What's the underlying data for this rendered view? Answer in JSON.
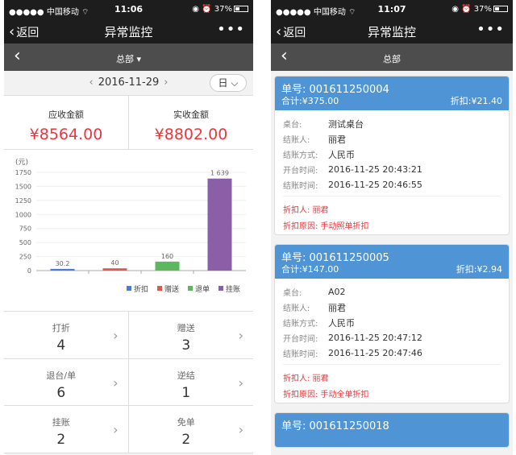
{
  "status_bar": {
    "left": [
      {
        "signal": "●●●●●",
        "carrier": "中国移动",
        "wifi": "⌔",
        "time": "11:06",
        "alarm": "◉ ⏰",
        "battery": "37%",
        "battery_level": 0.37
      },
      {
        "signal": "●●●●●",
        "carrier": "中国移动",
        "wifi": "⌔",
        "time": "11:07",
        "alarm": "◉ ⏰",
        "battery": "37%",
        "battery_level": 0.37
      }
    ]
  },
  "nav": {
    "back": "返回",
    "title": "异常监控",
    "more": "•••"
  },
  "left": {
    "sub_title": "总部 ▾",
    "date": "2016-11-29",
    "period": "日 ⌵",
    "receivable_label": "应收金额",
    "receivable_value": "¥8564.00",
    "received_label": "实收金额",
    "received_value": "¥8802.00",
    "grid": [
      {
        "label": "打折",
        "count": "4"
      },
      {
        "label": "赠送",
        "count": "3"
      },
      {
        "label": "退台/单",
        "count": "6"
      },
      {
        "label": "逆结",
        "count": "1"
      },
      {
        "label": "挂账",
        "count": "2"
      },
      {
        "label": "免单",
        "count": "2"
      }
    ]
  },
  "right": {
    "sub_title": "总部",
    "cards": [
      {
        "no_label": "单号:",
        "no": "001611250004",
        "sum_label": "合计:",
        "sum": "¥375.00",
        "disc_label": "折扣:",
        "disc": "¥21.40",
        "rows": [
          {
            "k": "桌台:",
            "v": "测试桌台"
          },
          {
            "k": "结账人:",
            "v": "丽君"
          },
          {
            "k": "结账方式:",
            "v": "人民币"
          },
          {
            "k": "开台时间:",
            "v": "2016-11-25 20:43:21"
          },
          {
            "k": "结账时间:",
            "v": "2016-11-25 20:46:55"
          }
        ],
        "discounter": "折扣人: 丽君",
        "reason": "折扣原因: 手动照单折扣"
      },
      {
        "no_label": "单号:",
        "no": "001611250005",
        "sum_label": "合计:",
        "sum": "¥147.00",
        "disc_label": "折扣:",
        "disc": "¥2.94",
        "rows": [
          {
            "k": "桌台:",
            "v": "A02"
          },
          {
            "k": "结账人:",
            "v": "丽君"
          },
          {
            "k": "结账方式:",
            "v": "人民币"
          },
          {
            "k": "开台时间:",
            "v": "2016-11-25 20:47:12"
          },
          {
            "k": "结账时间:",
            "v": "2016-11-25 20:47:46"
          }
        ],
        "discounter": "折扣人: 丽君",
        "reason": "折扣原因: 手动全单折扣"
      },
      {
        "no_label": "单号:",
        "no": "001611250018"
      }
    ]
  },
  "colors": {
    "accent_blue": "#4f94d4",
    "money_red": "#e8383d",
    "dark_bar": "#1d1d1d"
  },
  "chart_data": {
    "type": "bar",
    "ylabel": "(元)",
    "ylim": [
      0,
      1750
    ],
    "yticks": [
      "0",
      "250",
      "500",
      "750",
      "1000",
      "1250",
      "1500",
      "1750"
    ],
    "categories": [
      "折扣",
      "赠送",
      "退单",
      "挂账"
    ],
    "values": [
      30.2,
      40,
      160,
      1639
    ],
    "value_labels": [
      "30.2",
      "40",
      "160",
      "1 639"
    ],
    "colors": [
      "#4a7bd1",
      "#e0574f",
      "#5cb85c",
      "#8b5fa8"
    ],
    "legend": [
      "折扣",
      "赠送",
      "退单",
      "挂账"
    ],
    "legend_placement": "bottom-right"
  }
}
